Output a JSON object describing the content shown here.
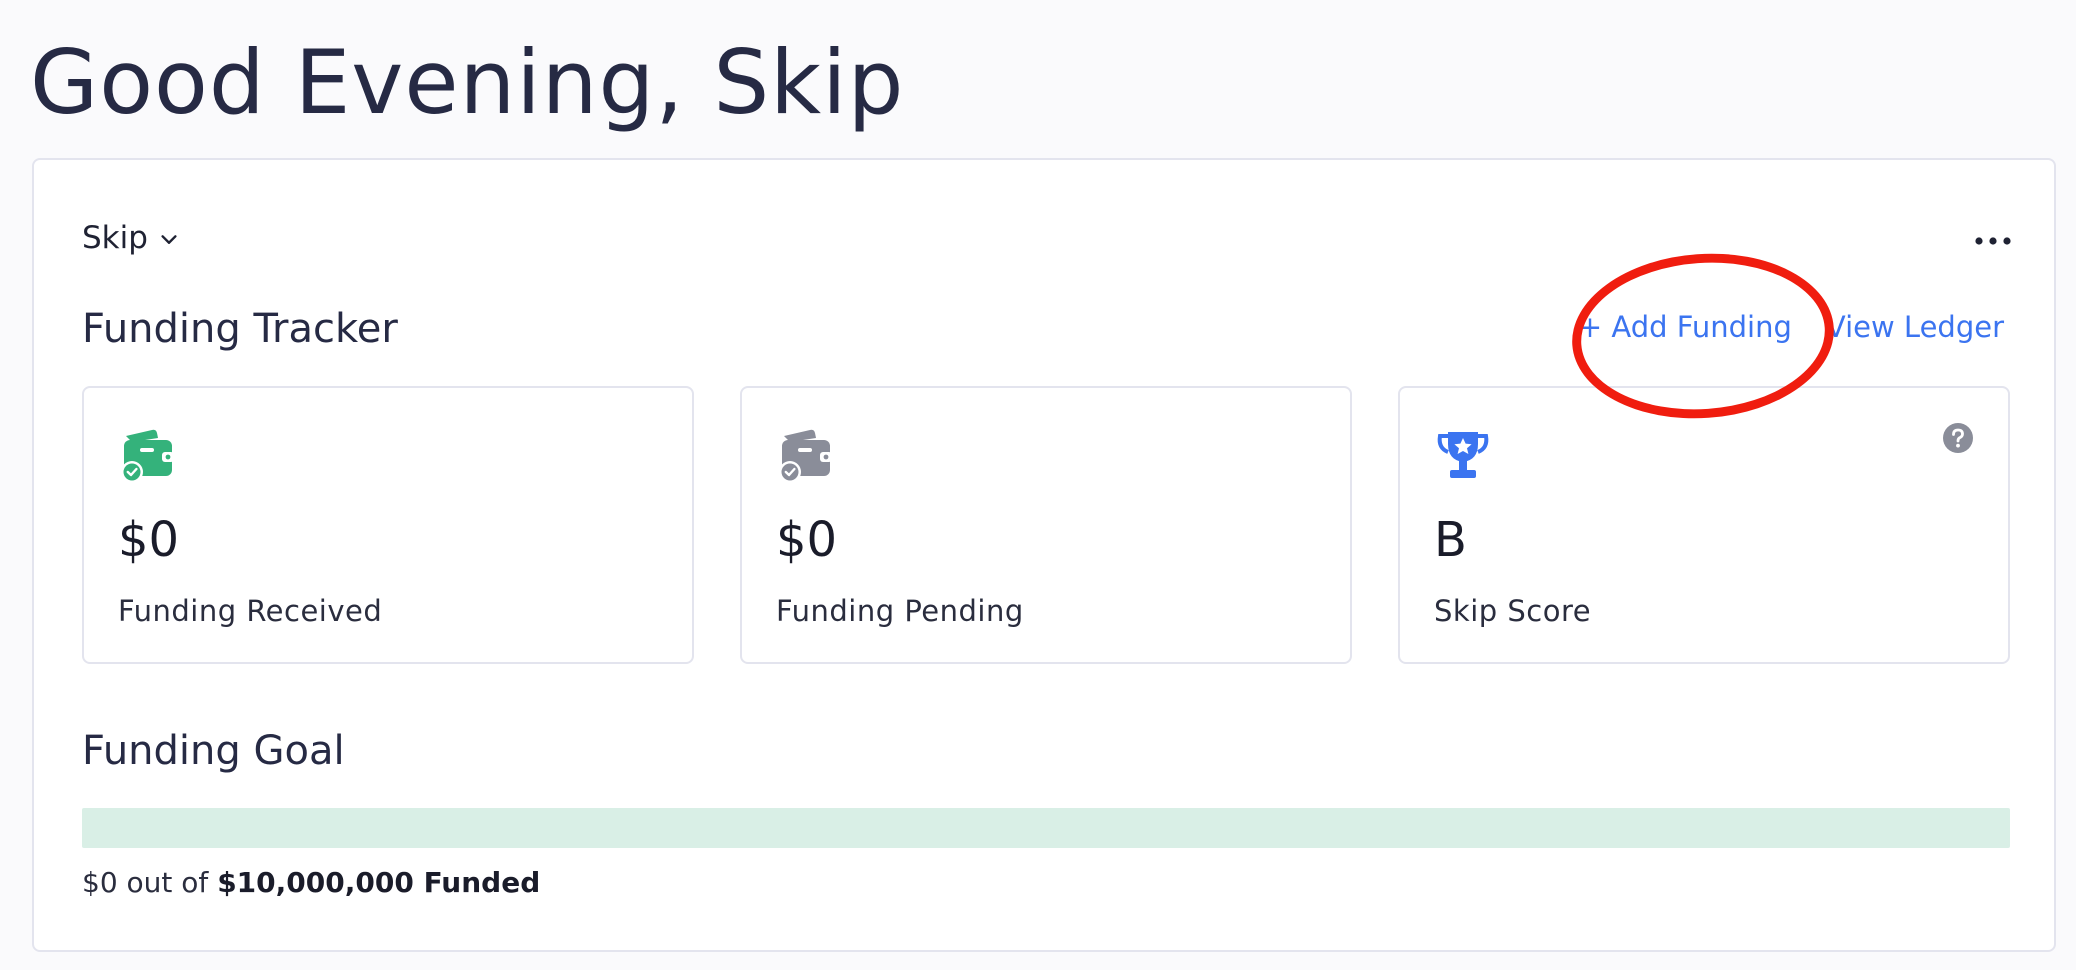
{
  "greeting": "Good Evening, Skip",
  "account": {
    "name": "Skip"
  },
  "funding_tracker": {
    "title": "Funding Tracker",
    "add_funding_label": "+ Add Funding",
    "view_ledger_label": "View Ledger",
    "stats": [
      {
        "value": "$0",
        "label": "Funding Received",
        "icon": "wallet-check-icon",
        "color": "#34b27b"
      },
      {
        "value": "$0",
        "label": "Funding Pending",
        "icon": "wallet-check-icon",
        "color": "#8a8d99"
      },
      {
        "value": "B",
        "label": "Skip Score",
        "icon": "trophy-icon",
        "color": "#3b74f0"
      }
    ]
  },
  "funding_goal": {
    "title": "Funding Goal",
    "progress_fraction": 0,
    "funded": "$0",
    "out_of_text": "out of",
    "goal": "$10,000,000 Funded",
    "bar_color": "#d9efe6"
  },
  "colors": {
    "accent": "#3b74f0",
    "success": "#34b27b",
    "annotation": "#f01d0f"
  }
}
